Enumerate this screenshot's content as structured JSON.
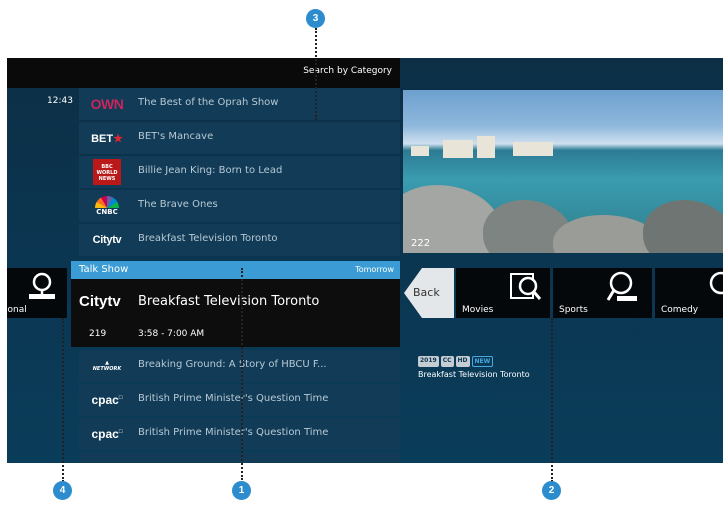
{
  "header": {
    "title": "Search by Category",
    "clock": "12:43"
  },
  "guide": {
    "rows_top": [
      {
        "logo": "OWN",
        "title": "The Best of the Oprah Show"
      },
      {
        "logo": "BET",
        "title": "BET's Mancave"
      },
      {
        "logo": "BBC WORLD NEWS",
        "title": "Billie Jean King: Born to Lead"
      },
      {
        "logo": "CNBC",
        "title": "The Brave Ones"
      },
      {
        "logo": "Citytv",
        "title": "Breakfast Television Toronto"
      }
    ],
    "rows_bottom": [
      {
        "logo": "NETWORK",
        "title": "Breaking Ground: A Story of HBCU F..."
      },
      {
        "logo": "cpac",
        "title": "British Prime Minister's Question Time"
      },
      {
        "logo": "cpac",
        "title": "British Prime Minister's Question Time"
      }
    ]
  },
  "selected": {
    "genre": "Talk Show",
    "when": "Tomorrow",
    "logo": "Citytv",
    "title": "Breakfast Television Toronto",
    "channel": "219",
    "time": "3:58 - 7:00 AM"
  },
  "preview": {
    "channel": "222"
  },
  "categories": {
    "back": "Back",
    "left_partial": "ional",
    "items": [
      "Movies",
      "Sports",
      "Comedy"
    ]
  },
  "info": {
    "badges": [
      "2019",
      "CC",
      "HD",
      "NEW"
    ],
    "title": "Breakfast Television Toronto"
  },
  "callouts": [
    "3",
    "1",
    "2",
    "4"
  ],
  "colors": {
    "accent": "#3a9bd5",
    "background": "#0b3550",
    "callout": "#2c8ccd"
  }
}
